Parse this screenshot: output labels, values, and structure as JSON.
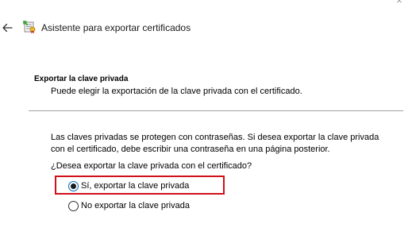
{
  "window": {
    "close_glyph": "×",
    "back_glyph": "←",
    "title": "Asistente para exportar certificados",
    "title_icon": "certificate-wizard-icon"
  },
  "section": {
    "heading": "Exportar la clave privada",
    "subheading": "Puede elegir la exportación de la clave privada con el certificado."
  },
  "content": {
    "description_line1": "Las claves privadas se protegen con contraseñas. Si desea exportar la clave privada",
    "description_line2": "con el certificado, debe escribir una contraseña en una página posterior.",
    "question": "¿Desea exportar la clave privada con el certificado?",
    "options": [
      {
        "label": "Sí, exportar la clave privada",
        "selected": true
      },
      {
        "label": "No exportar la clave privada",
        "selected": false
      }
    ]
  },
  "colors": {
    "highlight": "#d0101a",
    "divider": "#a0a0a0",
    "accent": "#0067c0"
  }
}
